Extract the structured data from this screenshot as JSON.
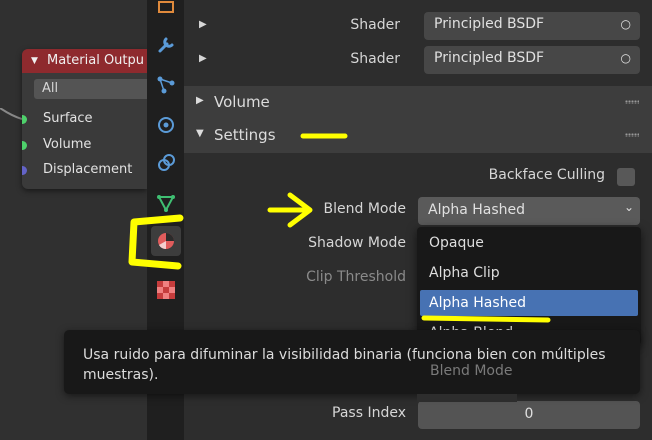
{
  "node": {
    "title": "Material Outpu",
    "dropdown_value": "All",
    "sockets": [
      {
        "label": "Surface",
        "color": "#4ed16b"
      },
      {
        "label": "Volume",
        "color": "#4ed16b"
      },
      {
        "label": "Displacement",
        "color": "#6363c7"
      }
    ]
  },
  "properties": {
    "rows": [
      {
        "label": "Shader",
        "value": "Principled BSDF"
      },
      {
        "label": "Shader",
        "value": "Principled BSDF"
      }
    ],
    "panels": {
      "volume": "Volume",
      "settings": "Settings"
    },
    "backface_culling_label": "Backface Culling",
    "blend_mode_label": "Blend Mode",
    "blend_mode_value": "Alpha Hashed",
    "shadow_mode_label": "Shadow Mode",
    "clip_threshold_label": "Clip Threshold",
    "pass_index_label": "Pass Index",
    "pass_index_value": "0"
  },
  "blend_menu": {
    "items": [
      "Opaque",
      "Alpha Clip",
      "Alpha Hashed",
      "Alpha Blend"
    ],
    "selected_index": 2,
    "behind_text": "Blend Mode"
  },
  "tooltip": {
    "text": "Usa ruido para difuminar la visibilidad binaria (funciona bien con múltiples muestras)."
  },
  "colors": {
    "accent": "#4772b3",
    "annotation": "#ffff00",
    "node_header": "#8e2a2e"
  }
}
